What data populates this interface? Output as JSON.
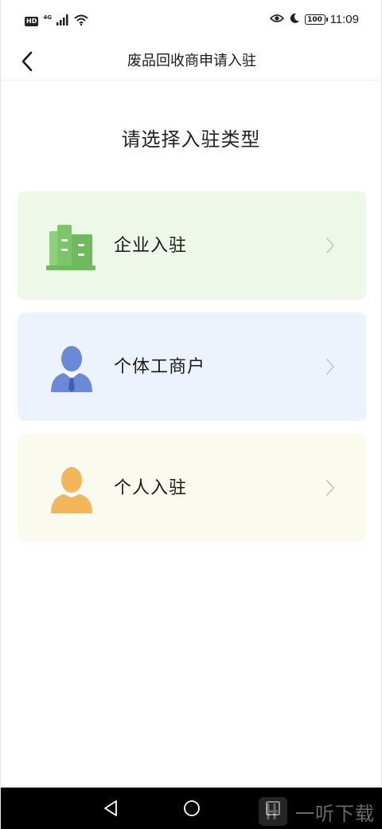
{
  "status_bar": {
    "hd_badge": "HD",
    "network_type": "4G",
    "battery_level": "100",
    "time": "11:09",
    "icons": [
      "signal-icon",
      "wifi-icon",
      "eye-icon",
      "moon-icon",
      "battery-icon"
    ]
  },
  "header": {
    "title": "废品回收商申请入驻",
    "back_icon": "chevron-left-icon"
  },
  "main": {
    "heading": "请选择入驻类型",
    "options": [
      {
        "label": "企业入驻",
        "icon": "building-icon",
        "bg_color": "#eef8e8",
        "icon_color": "#7cc56a"
      },
      {
        "label": "个体工商户",
        "icon": "businessman-icon",
        "bg_color": "#edf3fc",
        "icon_color": "#6b8ad6"
      },
      {
        "label": "个人入驻",
        "icon": "person-icon",
        "bg_color": "#fbfaee",
        "icon_color": "#f2b759"
      }
    ]
  },
  "system_nav": {
    "icons": [
      "back-triangle-icon",
      "home-circle-icon",
      "recents-square-icon"
    ]
  },
  "watermark": {
    "text": "一听下载"
  }
}
